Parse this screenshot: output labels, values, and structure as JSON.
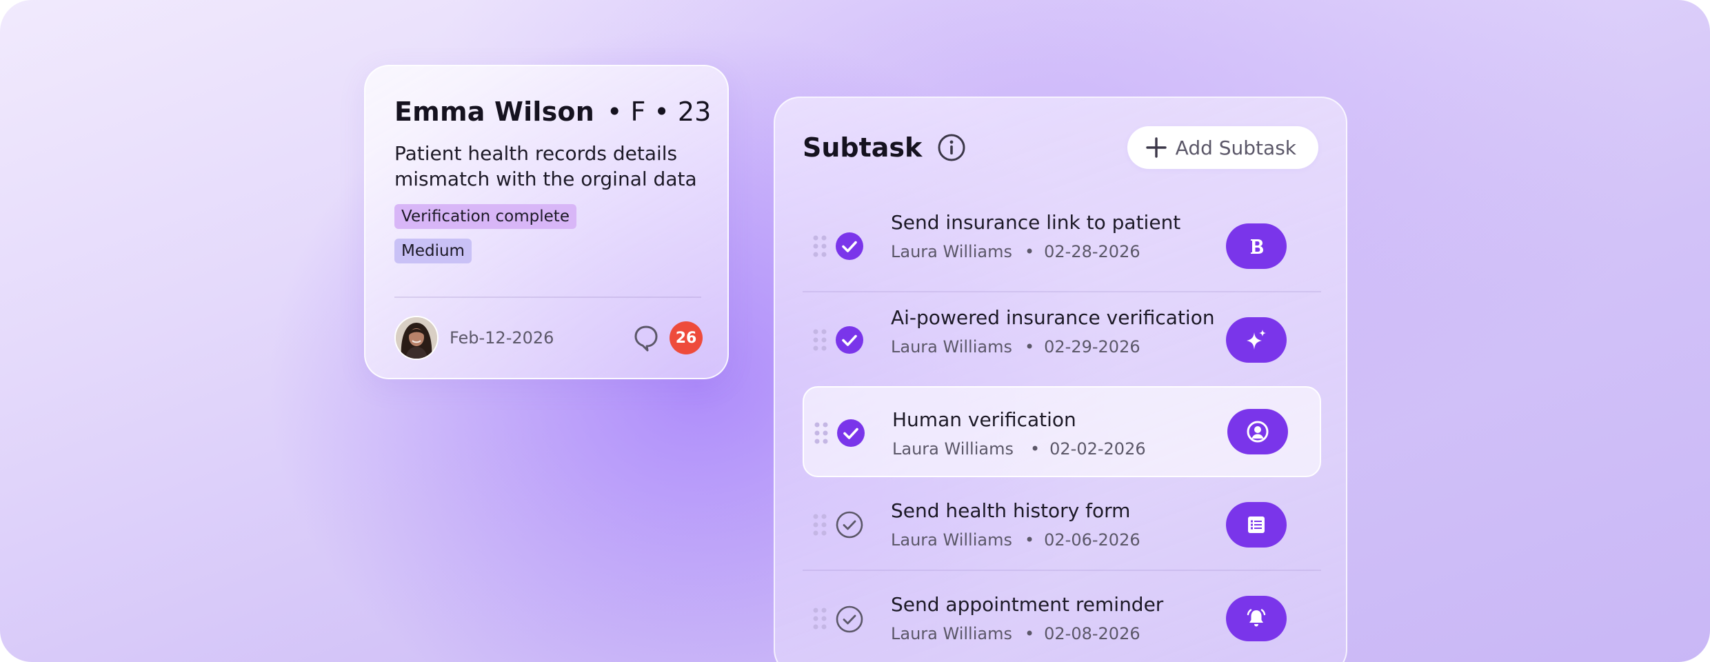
{
  "patient_card": {
    "name": "Emma Wilson",
    "meta": "• F • 23",
    "description": "Patient health records details mismatch with the orginal data",
    "tags": [
      "Verification complete",
      "Medium"
    ],
    "date": "Feb-12-2026",
    "comment_count": "26",
    "colors": {
      "tag_verify": "#d8b6f7",
      "tag_medium": "#c9c1f6",
      "badge": "#ee4b3b"
    }
  },
  "subtask_panel": {
    "title": "Subtask",
    "add_button_label": "Add Subtask",
    "accent_color": "#7a35ea",
    "items": [
      {
        "title": "Send insurance link to patient",
        "assignee": "Laura Williams",
        "date": "02-28-2026",
        "done": true,
        "icon": "bold-b-icon"
      },
      {
        "title": "Ai-powered insurance verification",
        "assignee": "Laura Williams",
        "date": "02-29-2026",
        "done": true,
        "icon": "sparkles-icon"
      },
      {
        "title": "Human verification",
        "assignee": "Laura Williams",
        "date": "02-02-2026",
        "done": true,
        "highlighted": true,
        "icon": "user-circle-icon"
      },
      {
        "title": "Send health history form",
        "assignee": "Laura Williams",
        "date": "02-06-2026",
        "done": false,
        "icon": "form-list-icon"
      },
      {
        "title": "Send appointment reminder",
        "assignee": "Laura Williams",
        "date": "02-08-2026",
        "done": false,
        "icon": "bell-ringing-icon"
      }
    ]
  }
}
